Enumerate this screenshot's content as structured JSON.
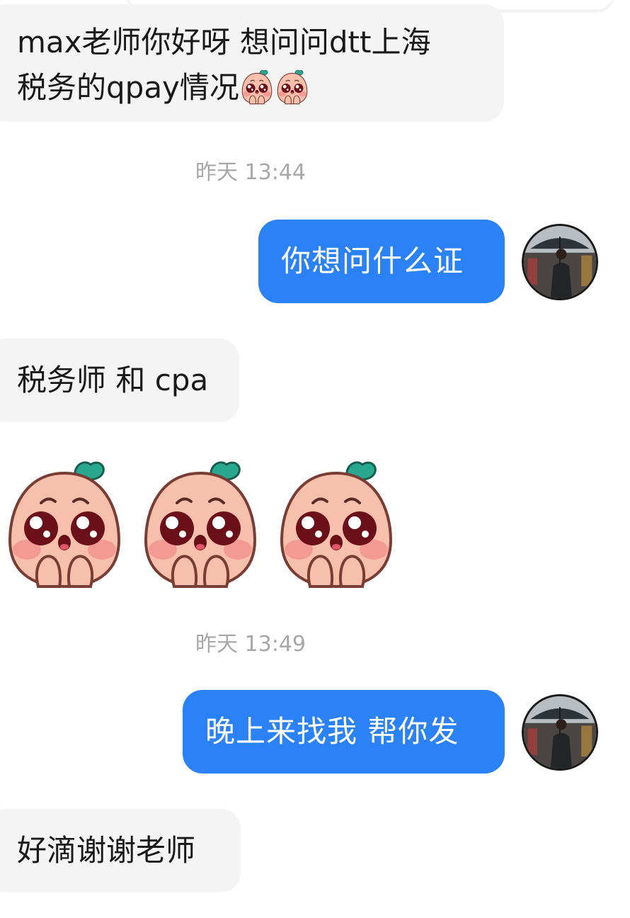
{
  "messages": {
    "m1": {
      "line1": "max老师你好呀 想问问dtt上海",
      "line2": "税务的qpay情况"
    },
    "t1": "昨天 13:44",
    "m2": "你想问什么证",
    "m3": "税务师 和 cpa",
    "t2": "昨天 13:49",
    "m4": "晚上来找我 帮你发",
    "m5": "好滴谢谢老师"
  },
  "icons": {
    "inline_emoji": "pleading-peach-emoji",
    "sticker": "pleading-peach-sticker",
    "avatar": "man-with-umbrella-avatar"
  },
  "colors": {
    "outgoing_bubble": "#2b82f6",
    "incoming_bubble": "#f4f4f4",
    "timestamp": "#a8a8a8"
  }
}
